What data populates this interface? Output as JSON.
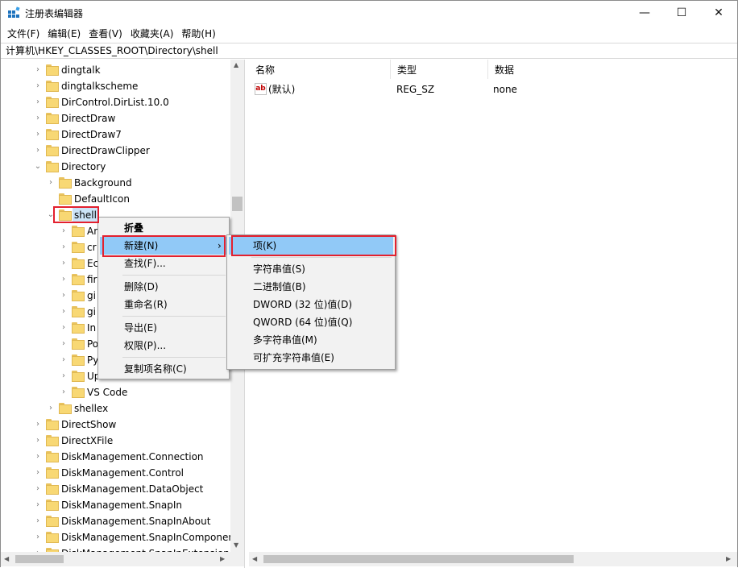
{
  "window": {
    "title": "注册表编辑器",
    "min_glyph": "—",
    "max_glyph": "☐",
    "close_glyph": "✕"
  },
  "menubar": {
    "items": [
      "文件(F)",
      "编辑(E)",
      "查看(V)",
      "收藏夹(A)",
      "帮助(H)"
    ]
  },
  "address": {
    "path": "计算机\\HKEY_CLASSES_ROOT\\Directory\\shell"
  },
  "tree": {
    "dingtalk": "dingtalk",
    "dingtalkscheme": "dingtalkscheme",
    "dircontrol": "DirControl.DirList.10.0",
    "directdraw": "DirectDraw",
    "directdraw7": "DirectDraw7",
    "directdrawclipper": "DirectDrawClipper",
    "directory": "Directory",
    "background": "Background",
    "defaulticon": "DefaultIcon",
    "shell": "shell",
    "child1": "An",
    "child2": "cr",
    "child3": "Ec",
    "child4": "fir",
    "child5": "gi",
    "child6": "gi",
    "child7": "In",
    "child8": "Po",
    "child9": "Py",
    "child10": "Up",
    "vscode": "VS Code",
    "shellex": "shellex",
    "directshow": "DirectShow",
    "directxfile": "DirectXFile",
    "dm_connection": "DiskManagement.Connection",
    "dm_control": "DiskManagement.Control",
    "dm_dataobject": "DiskManagement.DataObject",
    "dm_snapin": "DiskManagement.SnapIn",
    "dm_snapinabout": "DiskManagement.SnapInAbout",
    "dm_snapincomponent": "DiskManagement.SnapInComponen",
    "dm_partial": "DiskManagement.SnapInExtension"
  },
  "values": {
    "headers": {
      "name": "名称",
      "type": "类型",
      "data": "数据"
    },
    "rows": [
      {
        "name": "(默认)",
        "type": "REG_SZ",
        "data": "none",
        "icon": "ab-string-icon"
      }
    ]
  },
  "context_menu": {
    "collapse": "折叠",
    "new": "新建(N)",
    "new_arrow": "›",
    "find": "查找(F)...",
    "delete": "删除(D)",
    "rename": "重命名(R)",
    "export": "导出(E)",
    "permissions": "权限(P)...",
    "copy_key_name": "复制项名称(C)"
  },
  "submenu": {
    "key": "项(K)",
    "string_value": "字符串值(S)",
    "binary_value": "二进制值(B)",
    "dword_value": "DWORD (32 位)值(D)",
    "qword_value": "QWORD (64 位)值(Q)",
    "multi_string_value": "多字符串值(M)",
    "expandable_string_value": "可扩充字符串值(E)"
  },
  "colors": {
    "highlight": "#91c9f7",
    "annotation_box": "#e3202e",
    "folder": "#f8d874"
  }
}
